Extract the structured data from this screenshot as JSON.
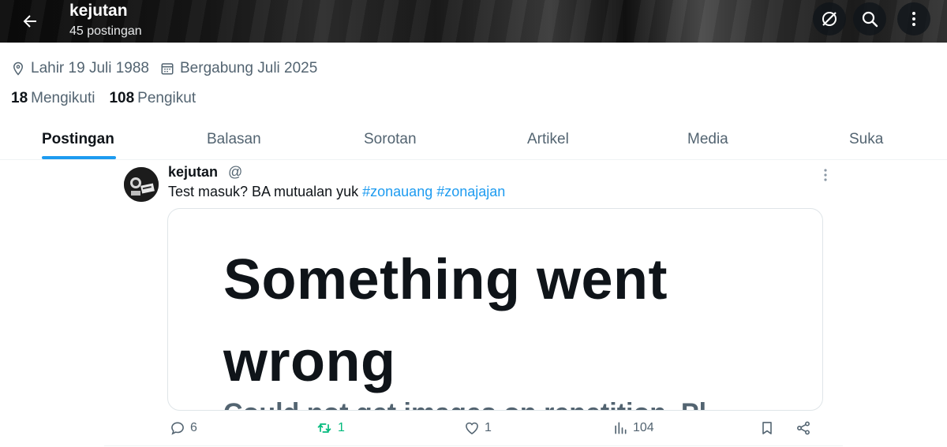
{
  "header": {
    "title": "kejutan",
    "subtitle": "45 postingan"
  },
  "profile": {
    "birth": "Lahir 19 Juli 1988",
    "joined": "Bergabung Juli 2025",
    "following_count": "18",
    "following_label": "Mengikuti",
    "followers_count": "108",
    "followers_label": "Pengikut"
  },
  "tabs": [
    {
      "label": "Postingan",
      "active": true
    },
    {
      "label": "Balasan",
      "active": false
    },
    {
      "label": "Sorotan",
      "active": false
    },
    {
      "label": "Artikel",
      "active": false
    },
    {
      "label": "Media",
      "active": false
    },
    {
      "label": "Suka",
      "active": false
    }
  ],
  "tweet": {
    "name": "kejutan",
    "handle": "@",
    "text": "Test masuk? BA mutualan yuk ",
    "hashtags": [
      "#zonauang",
      "#zonajajan"
    ],
    "media": {
      "line1": "Something went",
      "line2": "wrong",
      "peek": "Could not get images on repetition. Pl"
    },
    "actions": {
      "replies": "6",
      "retweets": "1",
      "likes": "1",
      "views": "104"
    }
  },
  "colors": {
    "accent": "#1d9bf0",
    "retweet": "#00ba7c",
    "muted": "#536471",
    "text": "#0f1419"
  }
}
